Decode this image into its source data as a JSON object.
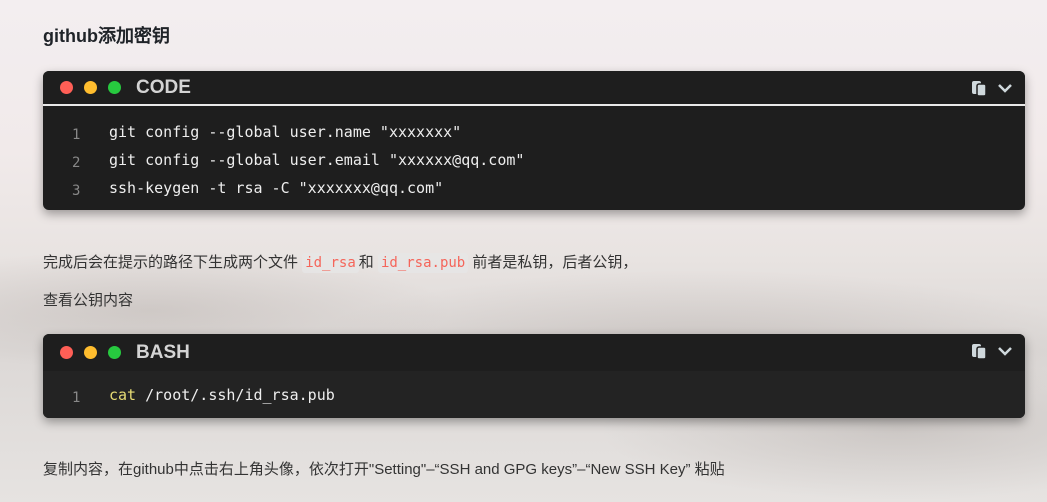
{
  "title": "github添加密钥",
  "colors": {
    "red": "#ff5f56",
    "yellow": "#ffbd2e",
    "green": "#27c93f"
  },
  "block1": {
    "lang": "CODE",
    "lines": [
      "git config --global user.name \"xxxxxxx\"",
      "git config --global user.email \"xxxxxx@qq.com\"",
      "ssh-keygen -t rsa -C \"xxxxxxx@qq.com\""
    ]
  },
  "para1": {
    "a": "完成后会在提示的路径下生成两个文件",
    "code1": "id_rsa",
    "b": "和",
    "code2": "id_rsa.pub",
    "c": "前者是私钥，后者公钥，"
  },
  "para2": "查看公钥内容",
  "block2": {
    "lang": "BASH",
    "cmd": "cat",
    "rest": " /root/.ssh/id_rsa.pub"
  },
  "para3": "复制内容，在github中点击右上角头像，依次打开\"Setting\"–“SSH and GPG keys”–“New SSH Key” 粘贴",
  "line_numbers": [
    "1",
    "2",
    "3"
  ]
}
